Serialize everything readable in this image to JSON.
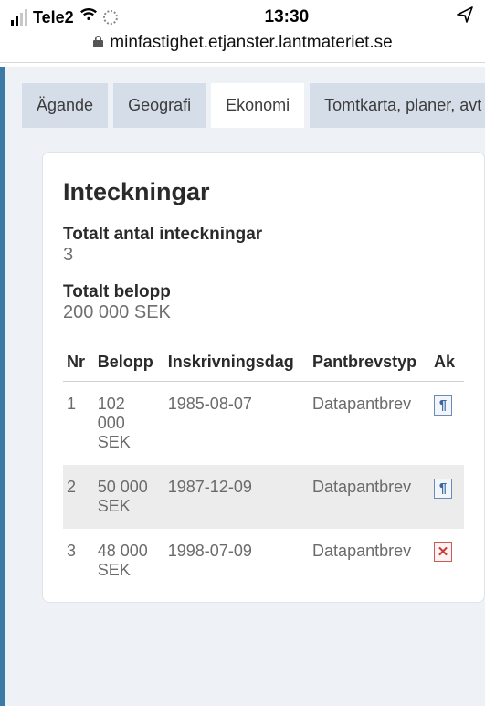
{
  "statusbar": {
    "carrier": "Tele2",
    "time": "13:30"
  },
  "browser": {
    "url": "minfastighet.etjanster.lantmateriet.se"
  },
  "tabs": [
    {
      "label": "Ägande",
      "active": false
    },
    {
      "label": "Geografi",
      "active": false
    },
    {
      "label": "Ekonomi",
      "active": true
    },
    {
      "label": "Tomtkarta, planer, avt",
      "active": false
    }
  ],
  "card": {
    "title": "Inteckningar",
    "total_count_label": "Totalt antal inteckningar",
    "total_count_value": "3",
    "total_amount_label": "Totalt belopp",
    "total_amount_value": "200 000 SEK"
  },
  "table": {
    "headers": {
      "nr": "Nr",
      "belopp": "Belopp",
      "dag": "Inskrivningsdag",
      "typ": "Pantbrevstyp",
      "ak": "Ak"
    },
    "rows": [
      {
        "nr": "1",
        "belopp": "102 000 SEK",
        "dag": "1985-08-07",
        "typ": "Datapantbrev",
        "action": "doc"
      },
      {
        "nr": "2",
        "belopp": "50 000 SEK",
        "dag": "1987-12-09",
        "typ": "Datapantbrev",
        "action": "doc"
      },
      {
        "nr": "3",
        "belopp": "48 000 SEK",
        "dag": "1998-07-09",
        "typ": "Datapantbrev",
        "action": "remove"
      }
    ]
  }
}
